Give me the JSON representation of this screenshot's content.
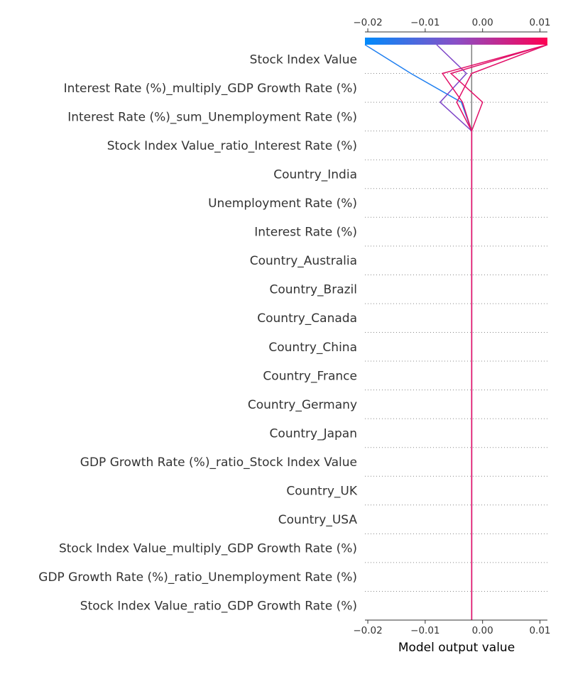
{
  "chart_data": {
    "type": "decision-plot",
    "title": "",
    "xlabel": "Model output value",
    "xlim": [
      -0.0205,
      0.0113
    ],
    "x_ticks": [
      -0.02,
      -0.01,
      0.0,
      0.01
    ],
    "x_tick_labels": [
      "−0.02",
      "−0.01",
      "0.00",
      "0.01"
    ],
    "base_value": -0.0019,
    "features_top_to_bottom": [
      "Stock Index Value",
      "Interest Rate (%)_multiply_GDP Growth Rate (%)",
      "Interest Rate (%)_sum_Unemployment Rate (%)",
      "Stock Index Value_ratio_Interest Rate (%)",
      "Country_India",
      "Unemployment Rate (%)",
      "Interest Rate (%)",
      "Country_Australia",
      "Country_Brazil",
      "Country_Canada",
      "Country_China",
      "Country_France",
      "Country_Germany",
      "Country_Japan",
      "GDP Growth Rate (%)_ratio_Stock Index Value",
      "Country_UK",
      "Country_USA",
      "Stock Index Value_multiply_GDP Growth Rate (%)",
      "GDP Growth Rate (%)_ratio_Unemployment Rate (%)",
      "Stock Index Value_ratio_GDP Growth Rate (%)"
    ],
    "colormap": [
      "#008afb",
      "#8a4fc6",
      "#ff0052"
    ],
    "series": [
      {
        "final_value": -0.0205,
        "color": "#1f7ff0",
        "cumulative_values_top_to_bottom": [
          -0.0205,
          -0.0125,
          -0.0037,
          -0.0019,
          -0.0019,
          -0.0019,
          -0.0019,
          -0.0019,
          -0.0019,
          -0.0019,
          -0.0019,
          -0.0019,
          -0.0019,
          -0.0019,
          -0.0019,
          -0.0019,
          -0.0019,
          -0.0019,
          -0.0019,
          -0.0019,
          -0.0019
        ]
      },
      {
        "final_value": -0.008,
        "color": "#7d44c8",
        "cumulative_values_top_to_bottom": [
          -0.008,
          -0.0028,
          -0.0074,
          -0.0019,
          -0.0019,
          -0.0019,
          -0.0019,
          -0.0019,
          -0.0019,
          -0.0019,
          -0.0019,
          -0.0019,
          -0.0019,
          -0.0019,
          -0.0019,
          -0.0019,
          -0.0019,
          -0.0019,
          -0.0019,
          -0.0019,
          -0.0019
        ]
      },
      {
        "final_value": 0.0113,
        "color": "#e21068",
        "cumulative_values_top_to_bottom": [
          0.0113,
          -0.007,
          -0.0035,
          -0.0019,
          -0.0019,
          -0.0019,
          -0.0019,
          -0.0019,
          -0.0019,
          -0.0019,
          -0.0019,
          -0.0019,
          -0.0019,
          -0.0019,
          -0.0019,
          -0.0019,
          -0.0019,
          -0.0019,
          -0.0019,
          -0.0019,
          -0.0019
        ]
      },
      {
        "final_value": 0.0113,
        "color": "#e21068",
        "cumulative_values_top_to_bottom": [
          0.0113,
          -0.0055,
          0.0,
          -0.0019,
          -0.0019,
          -0.0019,
          -0.0019,
          -0.0019,
          -0.0019,
          -0.0019,
          -0.0019,
          -0.0019,
          -0.0019,
          -0.0019,
          -0.0019,
          -0.0019,
          -0.0019,
          -0.0019,
          -0.0019,
          -0.0019,
          -0.0019
        ]
      },
      {
        "final_value": 0.0113,
        "color": "#e21068",
        "cumulative_values_top_to_bottom": [
          0.0113,
          -0.0019,
          -0.0045,
          -0.0019,
          -0.0019,
          -0.0019,
          -0.0019,
          -0.0019,
          -0.0019,
          -0.0019,
          -0.0019,
          -0.0019,
          -0.0019,
          -0.0019,
          -0.0019,
          -0.0019,
          -0.0019,
          -0.0019,
          -0.0019,
          -0.0019,
          -0.0019
        ]
      }
    ]
  }
}
